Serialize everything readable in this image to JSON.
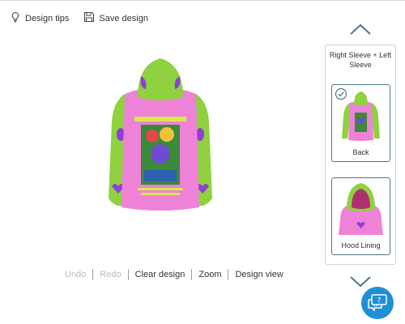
{
  "toolbar": {
    "design_tips_label": "Design tips",
    "save_design_label": "Save design"
  },
  "actions": {
    "undo": "Undo",
    "redo": "Redo",
    "clear": "Clear design",
    "zoom": "Zoom",
    "design_view": "Design view",
    "undo_enabled": false,
    "redo_enabled": false
  },
  "view_panel": {
    "header": "Right Sleeve + Left Sleeve",
    "cards": [
      {
        "label": "Back",
        "selected": true
      },
      {
        "label": "Hood Lining",
        "selected": false
      }
    ]
  },
  "icons": {
    "design_tips": "lightbulb-icon",
    "save_design": "floppy-disk-icon",
    "scroll_up": "chevron-up-icon",
    "scroll_down": "chevron-down-icon",
    "selected": "check-circle-icon",
    "chat": "chat-bubbles-icon"
  },
  "colors": {
    "hoodie_body": "#ee82d6",
    "sleeve": "#8fd13f",
    "accent_purple": "#8e3fd6",
    "chat_button": "#1f8fd6",
    "card_border": "#4a7a82"
  }
}
